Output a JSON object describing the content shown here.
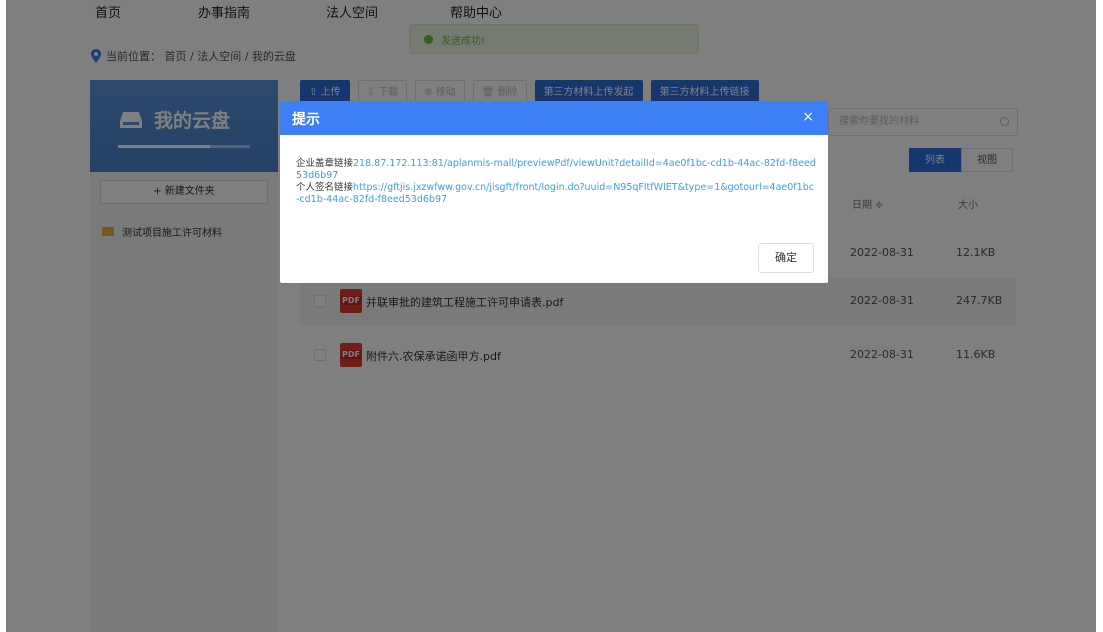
{
  "nav": {
    "items": [
      "首页",
      "办事指南",
      "法人空间",
      "帮助中心"
    ]
  },
  "breadcrumb": {
    "text": "当前位置：  首页 / 法人空间 / 我的云盘"
  },
  "toast": {
    "message": "发送成功!"
  },
  "sidebar": {
    "title": "我的云盘",
    "storage_used_fraction": 0.7,
    "new_folder": "+ 新建文件夹",
    "folders": [
      "测试项目施工许可材料"
    ]
  },
  "toolbar": {
    "upload": "上传",
    "download": "下载",
    "move": "移动",
    "delete": "删除",
    "third_party_upload": "第三方材料上传发起",
    "third_party_link": "第三方材料上传链接"
  },
  "search": {
    "placeholder": "搜索你要找的材料"
  },
  "view": {
    "list": "列表",
    "grid": "视图"
  },
  "table": {
    "headers": {
      "date": "日期 ≑",
      "size": "大小"
    },
    "rows": [
      {
        "name": "",
        "date": "2022-08-31",
        "size": "12.1KB"
      },
      {
        "name": "并联审批的建筑工程施工许可申请表.pdf",
        "date": "2022-08-31",
        "size": "247.7KB"
      },
      {
        "name": "附件六.农保承诺函甲方.pdf",
        "date": "2022-08-31",
        "size": "11.6KB"
      }
    ]
  },
  "dialog": {
    "title": "提示",
    "close": "×",
    "seal_label": "企业盖章链接",
    "seal_link": "218.87.172.113:81/aplanmis-mall/previewPdf/viewUnit?detailId=4ae0f1bc-cd1b-44ac-82fd-f8eed53d6b97",
    "sign_label": "个人签名链接",
    "sign_link": "https://gftjis.jxzwfww.gov.cn/jisgft/front/login.do?uuid=N95qFltfWIET&type=1&gotourl=4ae0f1bc-cd1b-44ac-82fd-f8eed53d6b97",
    "confirm": "确定"
  },
  "colors": {
    "primary": "#2d6de0",
    "dialog_header": "#3d7ff5",
    "link": "#3a9ee3",
    "success": "#67c23a",
    "pdf": "#e23b2e"
  }
}
